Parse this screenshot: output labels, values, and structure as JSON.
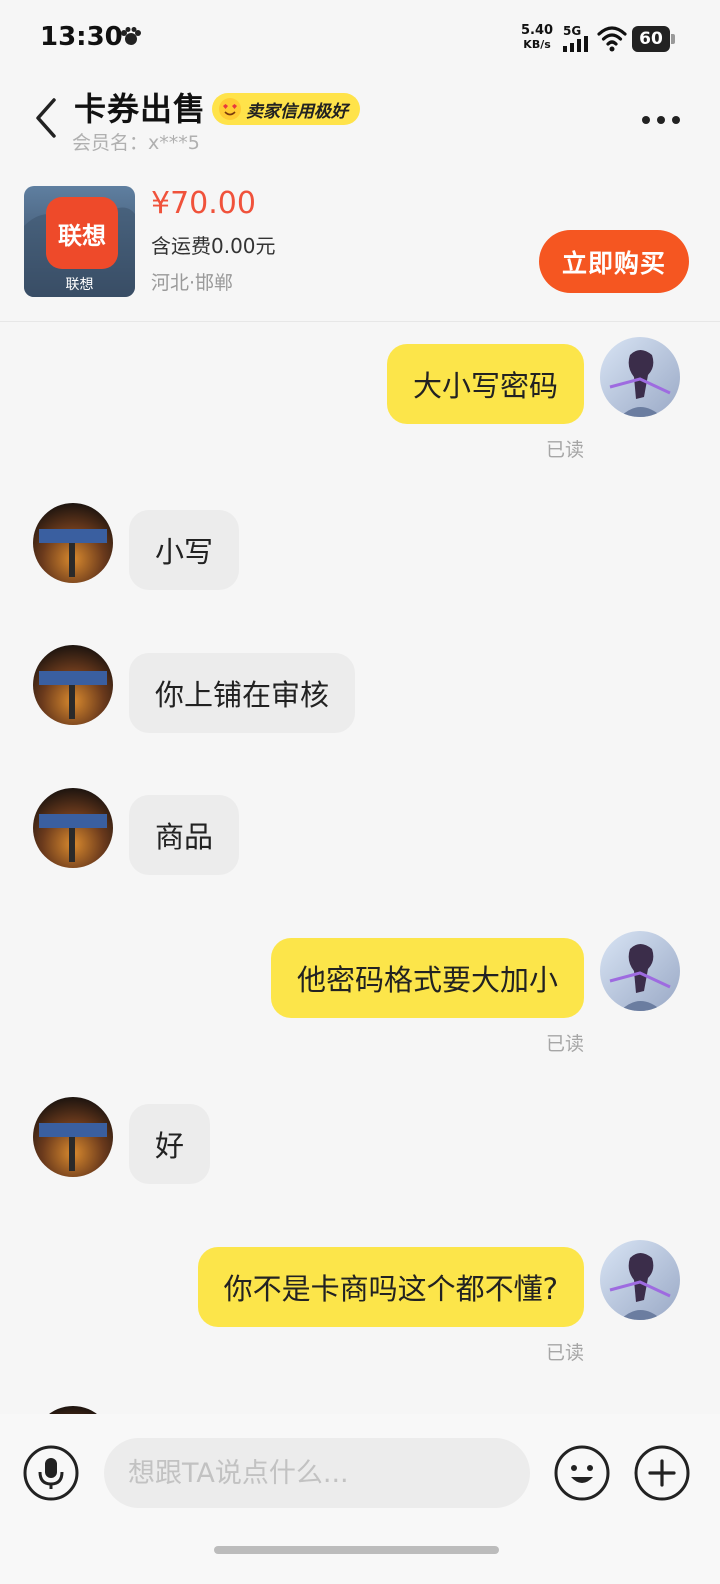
{
  "status_bar": {
    "time": "13:30",
    "net_speed_value": "5.40",
    "net_speed_unit": "KB/s",
    "network": "5G",
    "battery": "60"
  },
  "header": {
    "title": "卡券出售",
    "badge": "卖家信用极好",
    "member": "会员名：x***5"
  },
  "product": {
    "logo_text": "联想",
    "logo_caption": "联想",
    "price": "¥70.00",
    "shipping": "含运费0.00元",
    "location": "河北·邯郸",
    "buy_label": "立即购买"
  },
  "messages": [
    {
      "from": "me",
      "text": "大小写密码",
      "status": "已读"
    },
    {
      "from": "them",
      "text": "小写"
    },
    {
      "from": "them",
      "text": "你上铺在审核"
    },
    {
      "from": "them",
      "text": "商品"
    },
    {
      "from": "me",
      "text": "他密码格式要大加小",
      "status": "已读"
    },
    {
      "from": "them",
      "text": "好"
    },
    {
      "from": "me",
      "text": "你不是卡商吗这个都不懂?",
      "status": "已读"
    }
  ],
  "input": {
    "placeholder": "想跟TA说点什么..."
  },
  "colors": {
    "accent_yellow": "#fce54a",
    "buy_orange": "#f55621",
    "price_red": "#f0523b"
  }
}
